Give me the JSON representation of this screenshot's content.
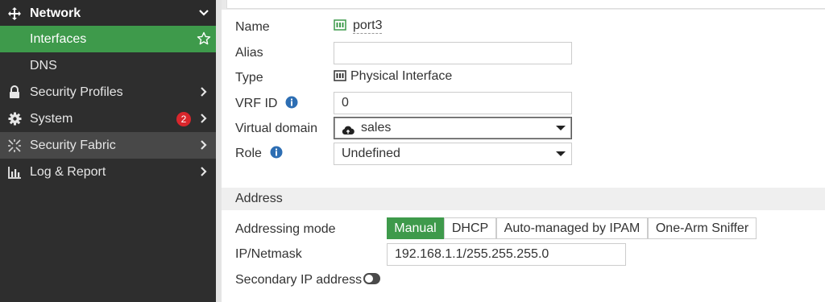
{
  "sidebar": {
    "network": {
      "label": "Network",
      "icon": "move-arrows-icon"
    },
    "items": [
      {
        "label": "Interfaces",
        "active": true
      },
      {
        "label": "DNS"
      }
    ],
    "sections": [
      {
        "label": "Security Profiles",
        "icon": "lock-icon"
      },
      {
        "label": "System",
        "icon": "gear-icon",
        "badge": "2"
      },
      {
        "label": "Security Fabric",
        "icon": "fabric-icon"
      },
      {
        "label": "Log & Report",
        "icon": "bar-chart-icon"
      }
    ]
  },
  "form": {
    "name": {
      "label": "Name",
      "value": "port3"
    },
    "alias": {
      "label": "Alias",
      "value": ""
    },
    "type": {
      "label": "Type",
      "value": "Physical Interface"
    },
    "vrf": {
      "label": "VRF ID",
      "value": "0"
    },
    "vdom": {
      "label": "Virtual domain",
      "value": "sales"
    },
    "role": {
      "label": "Role",
      "value": "Undefined"
    }
  },
  "address": {
    "section_title": "Address",
    "mode_label": "Addressing mode",
    "modes": [
      "Manual",
      "DHCP",
      "Auto-managed by IPAM",
      "One-Arm Sniffer"
    ],
    "selected_mode": "Manual",
    "ip_label": "IP/Netmask",
    "ip_value": "192.168.1.1/255.255.255.0",
    "secondary_label": "Secondary IP address",
    "secondary_enabled": false
  },
  "colors": {
    "accent": "#3e9a4b",
    "sidebar_bg": "#2e2e2e",
    "badge": "#d9262c",
    "info": "#2d6eb3"
  }
}
